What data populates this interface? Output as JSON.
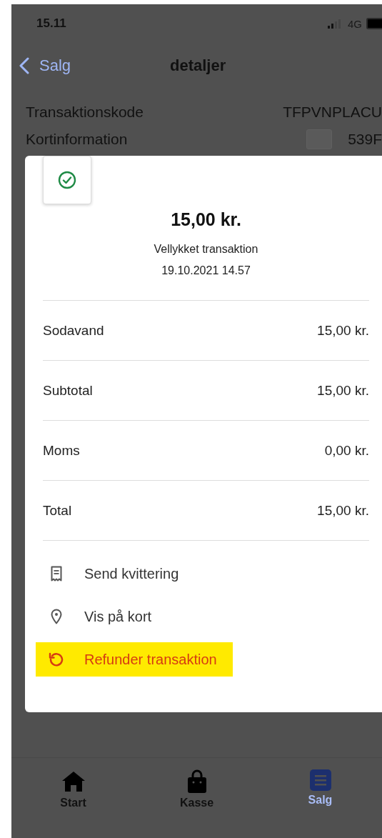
{
  "status_bar": {
    "time": "15.11",
    "network": "4G"
  },
  "nav": {
    "back": "Salg",
    "title": "detaljer"
  },
  "details": [
    {
      "kind": "text",
      "label": "Transaktionskode",
      "value": "TFPVNPLACU"
    },
    {
      "kind": "card",
      "label": "Kortinformation",
      "value": "539F"
    }
  ],
  "receipt": {
    "amount": "15,00 kr.",
    "message": "Vellykket transaktion",
    "date": "19.10.2021 14.57",
    "lines": [
      {
        "label": "Sodavand",
        "value": "15,00 kr."
      },
      {
        "label": "Subtotal",
        "value": "15,00 kr."
      },
      {
        "label": "Moms",
        "value": "0,00 kr."
      },
      {
        "label": "Total",
        "value": "15,00 kr."
      }
    ],
    "actions": [
      {
        "kind": "receipt",
        "label": "Send kvittering",
        "highlighted": false
      },
      {
        "kind": "map",
        "label": "Vis på kort",
        "highlighted": false
      },
      {
        "kind": "refund",
        "label": "Refunder transaktion",
        "highlighted": true
      }
    ]
  },
  "tabs": [
    {
      "kind": "home",
      "label": "Start",
      "selected": false
    },
    {
      "kind": "bag",
      "label": "Kasse",
      "selected": false
    },
    {
      "kind": "list",
      "label": "Salg",
      "selected": true
    }
  ]
}
